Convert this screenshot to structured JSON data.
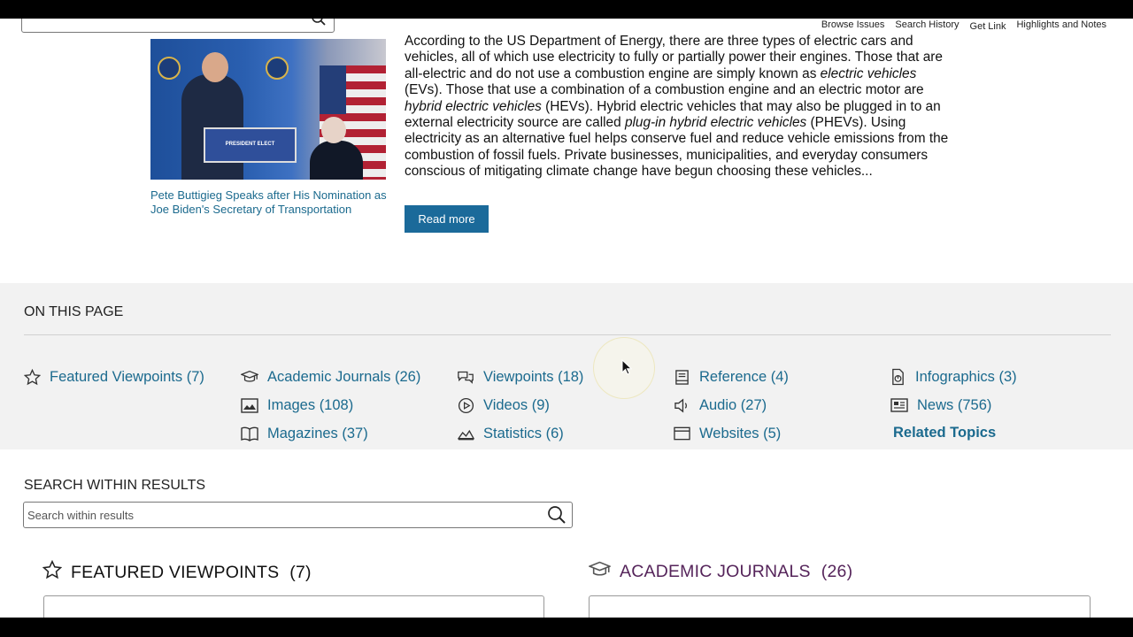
{
  "header": {
    "links": [
      "Browse Issues",
      "Search History",
      "Get Link",
      "Highlights and Notes"
    ]
  },
  "article": {
    "caption": "Pete Buttigieg Speaks after His Nomination as Joe Biden's Secretary of Transportation",
    "photo_sign": "PRESIDENT ELECT",
    "read_more": "Read more"
  },
  "on_this_page": {
    "title": "ON THIS PAGE",
    "links": [
      {
        "label": "Featured Viewpoints (7)",
        "icon": "star-icon"
      },
      {
        "label": "Academic Journals (26)",
        "icon": "graduation-cap-icon"
      },
      {
        "label": "Viewpoints (18)",
        "icon": "chat-bubbles-icon"
      },
      {
        "label": "Reference (4)",
        "icon": "book-icon"
      },
      {
        "label": "Infographics (3)",
        "icon": "document-chart-icon"
      },
      {
        "label": "Images (108)",
        "icon": "image-icon"
      },
      {
        "label": "Videos (9)",
        "icon": "play-icon"
      },
      {
        "label": "Audio (27)",
        "icon": "speaker-icon"
      },
      {
        "label": "News (756)",
        "icon": "newspaper-icon"
      },
      {
        "label": "Magazines (37)",
        "icon": "open-book-icon"
      },
      {
        "label": "Statistics (6)",
        "icon": "area-chart-icon"
      },
      {
        "label": "Websites (5)",
        "icon": "browser-window-icon"
      },
      {
        "label": "Related Topics",
        "icon": ""
      }
    ]
  },
  "search_within": {
    "title": "SEARCH WITHIN RESULTS",
    "placeholder": "Search within results"
  },
  "sections": {
    "featured": {
      "label": "FEATURED VIEWPOINTS",
      "count": "(7)"
    },
    "journals": {
      "label": "ACADEMIC JOURNALS",
      "count": "(26)"
    }
  },
  "colors": {
    "link": "#1b6a8e",
    "button": "#1b6a9a",
    "panel": "#f2f2f2",
    "journals_heading": "#55245a"
  }
}
